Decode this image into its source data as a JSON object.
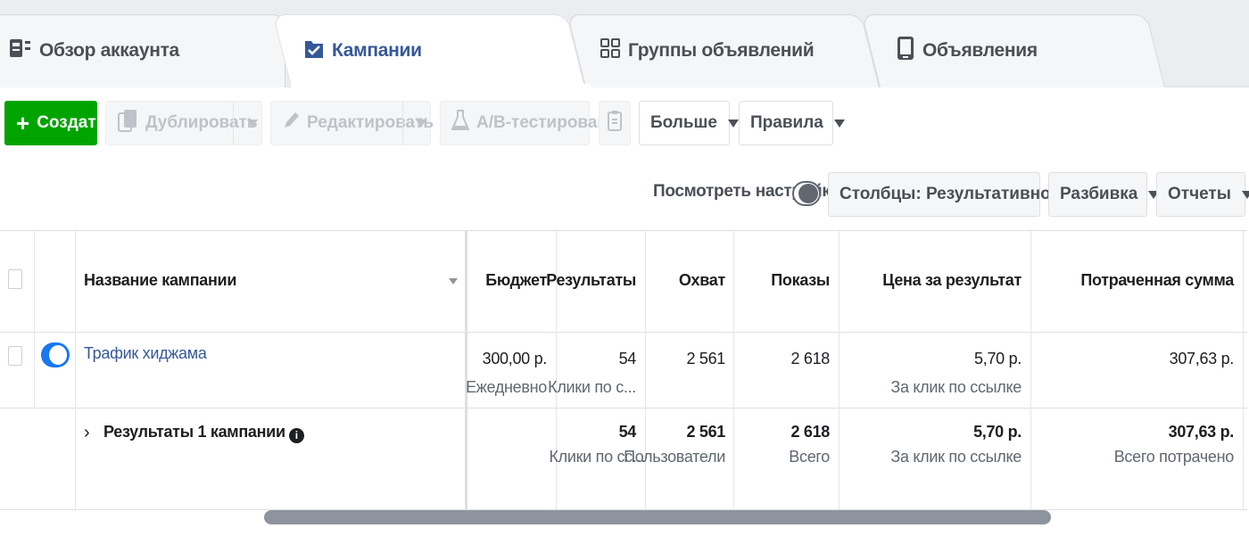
{
  "tabs": [
    {
      "label": "Обзор аккаунта",
      "icon": "dashboard-icon"
    },
    {
      "label": "Кампании",
      "icon": "checked-folder-icon"
    },
    {
      "label": "Группы объявлений",
      "icon": "grid-icon"
    },
    {
      "label": "Объявления",
      "icon": "phone-icon"
    }
  ],
  "toolbar": {
    "create": "Создать",
    "duplicate": "Дублировать",
    "edit": "Редактировать",
    "ab_test": "A/B-тестирование",
    "more": "Больше",
    "rules": "Правила"
  },
  "view_settings": "Посмотреть настройки",
  "columns_btn": "Столбцы: Результативность",
  "breakdown_btn": "Разбивка",
  "reports_btn": "Отчеты",
  "table": {
    "headers": {
      "name": "Название кампании",
      "budget": "Бюджет",
      "results": "Результаты",
      "reach": "Охват",
      "impressions": "Показы",
      "cost_per_result": "Цена за результат",
      "spent": "Потраченная сумма"
    },
    "row": {
      "name": "Трафик хиджама",
      "budget": "300,00 р.",
      "budget_sub": "Ежедневно",
      "results": "54",
      "results_sub": "Клики по с...",
      "reach": "2 561",
      "impressions": "2 618",
      "cost": "5,70 р.",
      "cost_sub": "За клик по ссылке",
      "spent": "307,63 р."
    },
    "summary": {
      "label": "Результаты 1 кампании",
      "results": "54",
      "results_sub": "Клики по сс...",
      "reach": "2 561",
      "reach_sub": "Пользователи",
      "impressions": "2 618",
      "impressions_sub": "Всего",
      "cost": "5,70 р.",
      "cost_sub": "За клик по ссылке",
      "spent": "307,63 р.",
      "spent_sub": "Всего потрачено"
    }
  },
  "colors": {
    "accent": "#365899",
    "create": "#00a400",
    "toggle_on": "#1877f2"
  }
}
